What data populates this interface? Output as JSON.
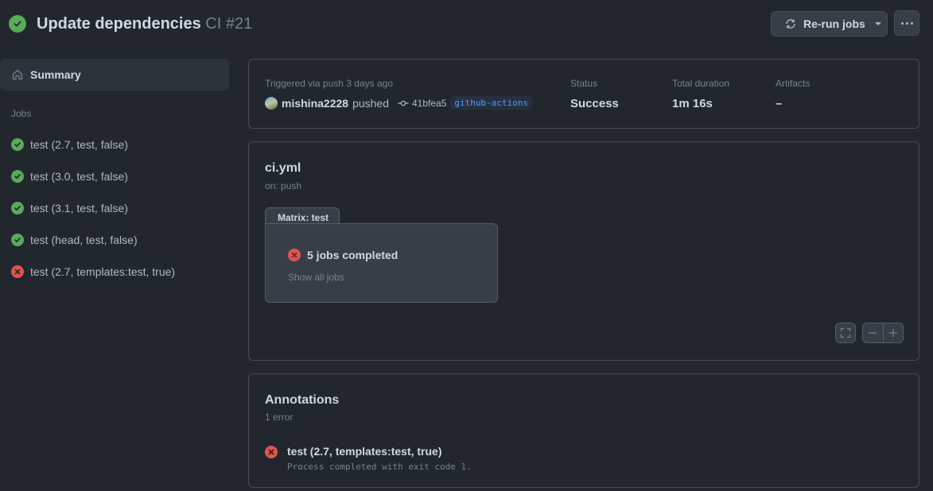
{
  "header": {
    "title": "Update dependencies",
    "workflow": "CI",
    "run_number": "#21",
    "rerun_label": "Re-run jobs"
  },
  "sidebar": {
    "summary_label": "Summary",
    "jobs_heading": "Jobs",
    "jobs": [
      {
        "label": "test (2.7, test, false)",
        "status": "success"
      },
      {
        "label": "test (3.0, test, false)",
        "status": "success"
      },
      {
        "label": "test (3.1, test, false)",
        "status": "success"
      },
      {
        "label": "test (head, test, false)",
        "status": "success"
      },
      {
        "label": "test (2.7, templates:test, true)",
        "status": "failure"
      }
    ]
  },
  "run_info": {
    "trigger": "Triggered via push 3 days ago",
    "actor": "mishina2228",
    "action": "pushed",
    "commit": "41bfea5",
    "branch": "github-actions",
    "status_label": "Status",
    "status_value": "Success",
    "duration_label": "Total duration",
    "duration_value": "1m 16s",
    "artifacts_label": "Artifacts",
    "artifacts_value": "–"
  },
  "workflow": {
    "file": "ci.yml",
    "on": "on: push",
    "matrix_label": "Matrix: test",
    "matrix_status": "5 jobs completed",
    "show_all": "Show all jobs"
  },
  "annotations": {
    "title": "Annotations",
    "count": "1 error",
    "items": [
      {
        "job": "test (2.7, templates:test, true)",
        "message": "Process completed with exit code 1."
      }
    ]
  },
  "colors": {
    "background": "#22272e",
    "success": "#57ab5a",
    "failure": "#e5534b",
    "link": "#539bf5"
  }
}
